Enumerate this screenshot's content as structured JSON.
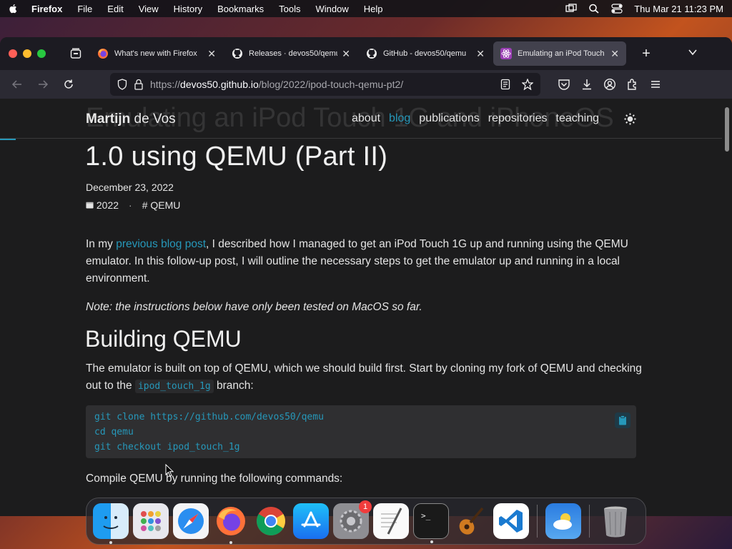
{
  "menubar": {
    "app_name": "Firefox",
    "items": [
      "File",
      "Edit",
      "View",
      "History",
      "Bookmarks",
      "Tools",
      "Window",
      "Help"
    ],
    "datetime": "Thu Mar 21  11:23 PM"
  },
  "tabs": [
    {
      "label": "What's new with Firefox",
      "icon": "firefox-icon"
    },
    {
      "label": "Releases · devos50/qemu",
      "icon": "github-icon"
    },
    {
      "label": "GitHub - devos50/qemu",
      "icon": "github-icon"
    },
    {
      "label": "Emulating an iPod Touch",
      "icon": "react-icon"
    }
  ],
  "url": {
    "scheme": "https://",
    "host": "devos50.github.io",
    "path": "/blog/2022/ipod-touch-qemu-pt2/"
  },
  "site": {
    "brand_first": "Martijn",
    "brand_last": " de Vos",
    "nav": [
      "about",
      "blog",
      "publications",
      "repositories",
      "teaching"
    ],
    "active_nav": "blog",
    "ghost_title": "Emulating an iPod Touch 1G and iPhoneOS"
  },
  "post": {
    "title": "1.0 using QEMU (Part II)",
    "date": "December 23, 2022",
    "year": "2022",
    "tag": "QEMU",
    "p1_before": "In my ",
    "p1_link": "previous blog post",
    "p1_after": ", I described how I managed to get an iPod Touch 1G up and running using the QEMU emulator. In this follow-up post, I will outline the necessary steps to get the emulator up and running in a local environment.",
    "note": "Note: the instructions below have only been tested on MacOS so far.",
    "h2": "Building QEMU",
    "p3_before": "The emulator is built on top of QEMU, which we should build first. Start by cloning my fork of QEMU and checking out to the ",
    "p3_code": "ipod_touch_1g",
    "p3_after": " branch:",
    "code_lines": [
      "git clone https://github.com/devos50/qemu",
      "cd qemu",
      "git checkout ipod_touch_1g"
    ],
    "p4": "Compile QEMU by running the following commands:"
  },
  "dock": {
    "apps": [
      "finder",
      "launchpad",
      "safari",
      "firefox",
      "chrome",
      "app-store",
      "system-settings",
      "textedit",
      "terminal",
      "garageband",
      "vscode",
      "weather",
      "trash"
    ],
    "settings_badge": "1"
  },
  "colors": {
    "accent": "#2698ba",
    "background": "#1c1c1d",
    "text": "#e4e4e4"
  }
}
